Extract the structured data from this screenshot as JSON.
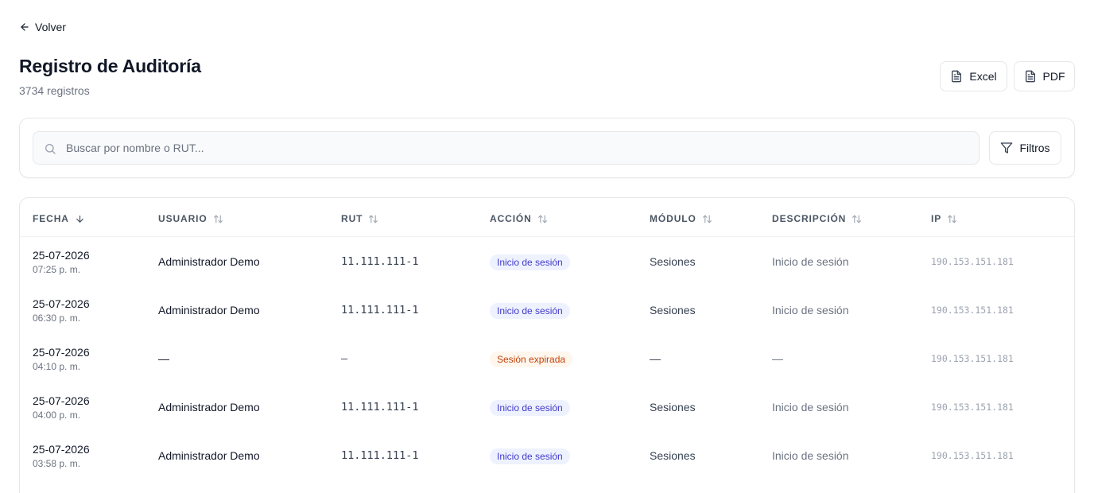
{
  "nav": {
    "back_label": "Volver"
  },
  "header": {
    "title": "Registro de Auditoría",
    "count_text": "3734 registros"
  },
  "export": {
    "excel_label": "Excel",
    "pdf_label": "PDF"
  },
  "search": {
    "placeholder": "Buscar por nombre o RUT...",
    "value": ""
  },
  "filters": {
    "label": "Filtros"
  },
  "table": {
    "columns": [
      "FECHA",
      "USUARIO",
      "RUT",
      "ACCIÓN",
      "MÓDULO",
      "DESCRIPCIÓN",
      "IP"
    ],
    "sort": {
      "column": "FECHA",
      "direction": "desc"
    },
    "rows": [
      {
        "date": "25-07-2026",
        "time": "07:25 p. m.",
        "user": "Administrador Demo",
        "rut": "11.111.111-1",
        "action": "Inicio de sesión",
        "action_type": "login",
        "module": "Sesiones",
        "description": "Inicio de sesión",
        "ip": "190.153.151.181"
      },
      {
        "date": "25-07-2026",
        "time": "06:30 p. m.",
        "user": "Administrador Demo",
        "rut": "11.111.111-1",
        "action": "Inicio de sesión",
        "action_type": "login",
        "module": "Sesiones",
        "description": "Inicio de sesión",
        "ip": "190.153.151.181"
      },
      {
        "date": "25-07-2026",
        "time": "04:10 p. m.",
        "user": "—",
        "rut": "–",
        "action": "Sesión expirada",
        "action_type": "expired",
        "module": "—",
        "description": "—",
        "ip": "190.153.151.181"
      },
      {
        "date": "25-07-2026",
        "time": "04:00 p. m.",
        "user": "Administrador Demo",
        "rut": "11.111.111-1",
        "action": "Inicio de sesión",
        "action_type": "login",
        "module": "Sesiones",
        "description": "Inicio de sesión",
        "ip": "190.153.151.181"
      },
      {
        "date": "25-07-2026",
        "time": "03:58 p. m.",
        "user": "Administrador Demo",
        "rut": "11.111.111-1",
        "action": "Inicio de sesión",
        "action_type": "login",
        "module": "Sesiones",
        "description": "Inicio de sesión",
        "ip": "190.153.151.181"
      }
    ]
  },
  "colors": {
    "badge_login_bg": "#eef2ff",
    "badge_login_text": "#4338ca",
    "badge_expired_bg": "#fff7ed",
    "badge_expired_text": "#c2410c"
  },
  "icons": {
    "back": "arrow-left-icon",
    "excel": "file-icon",
    "pdf": "file-icon",
    "search": "search-icon",
    "filter": "filter-icon",
    "sort_active": "arrow-down-icon",
    "sort": "sort-icon"
  }
}
